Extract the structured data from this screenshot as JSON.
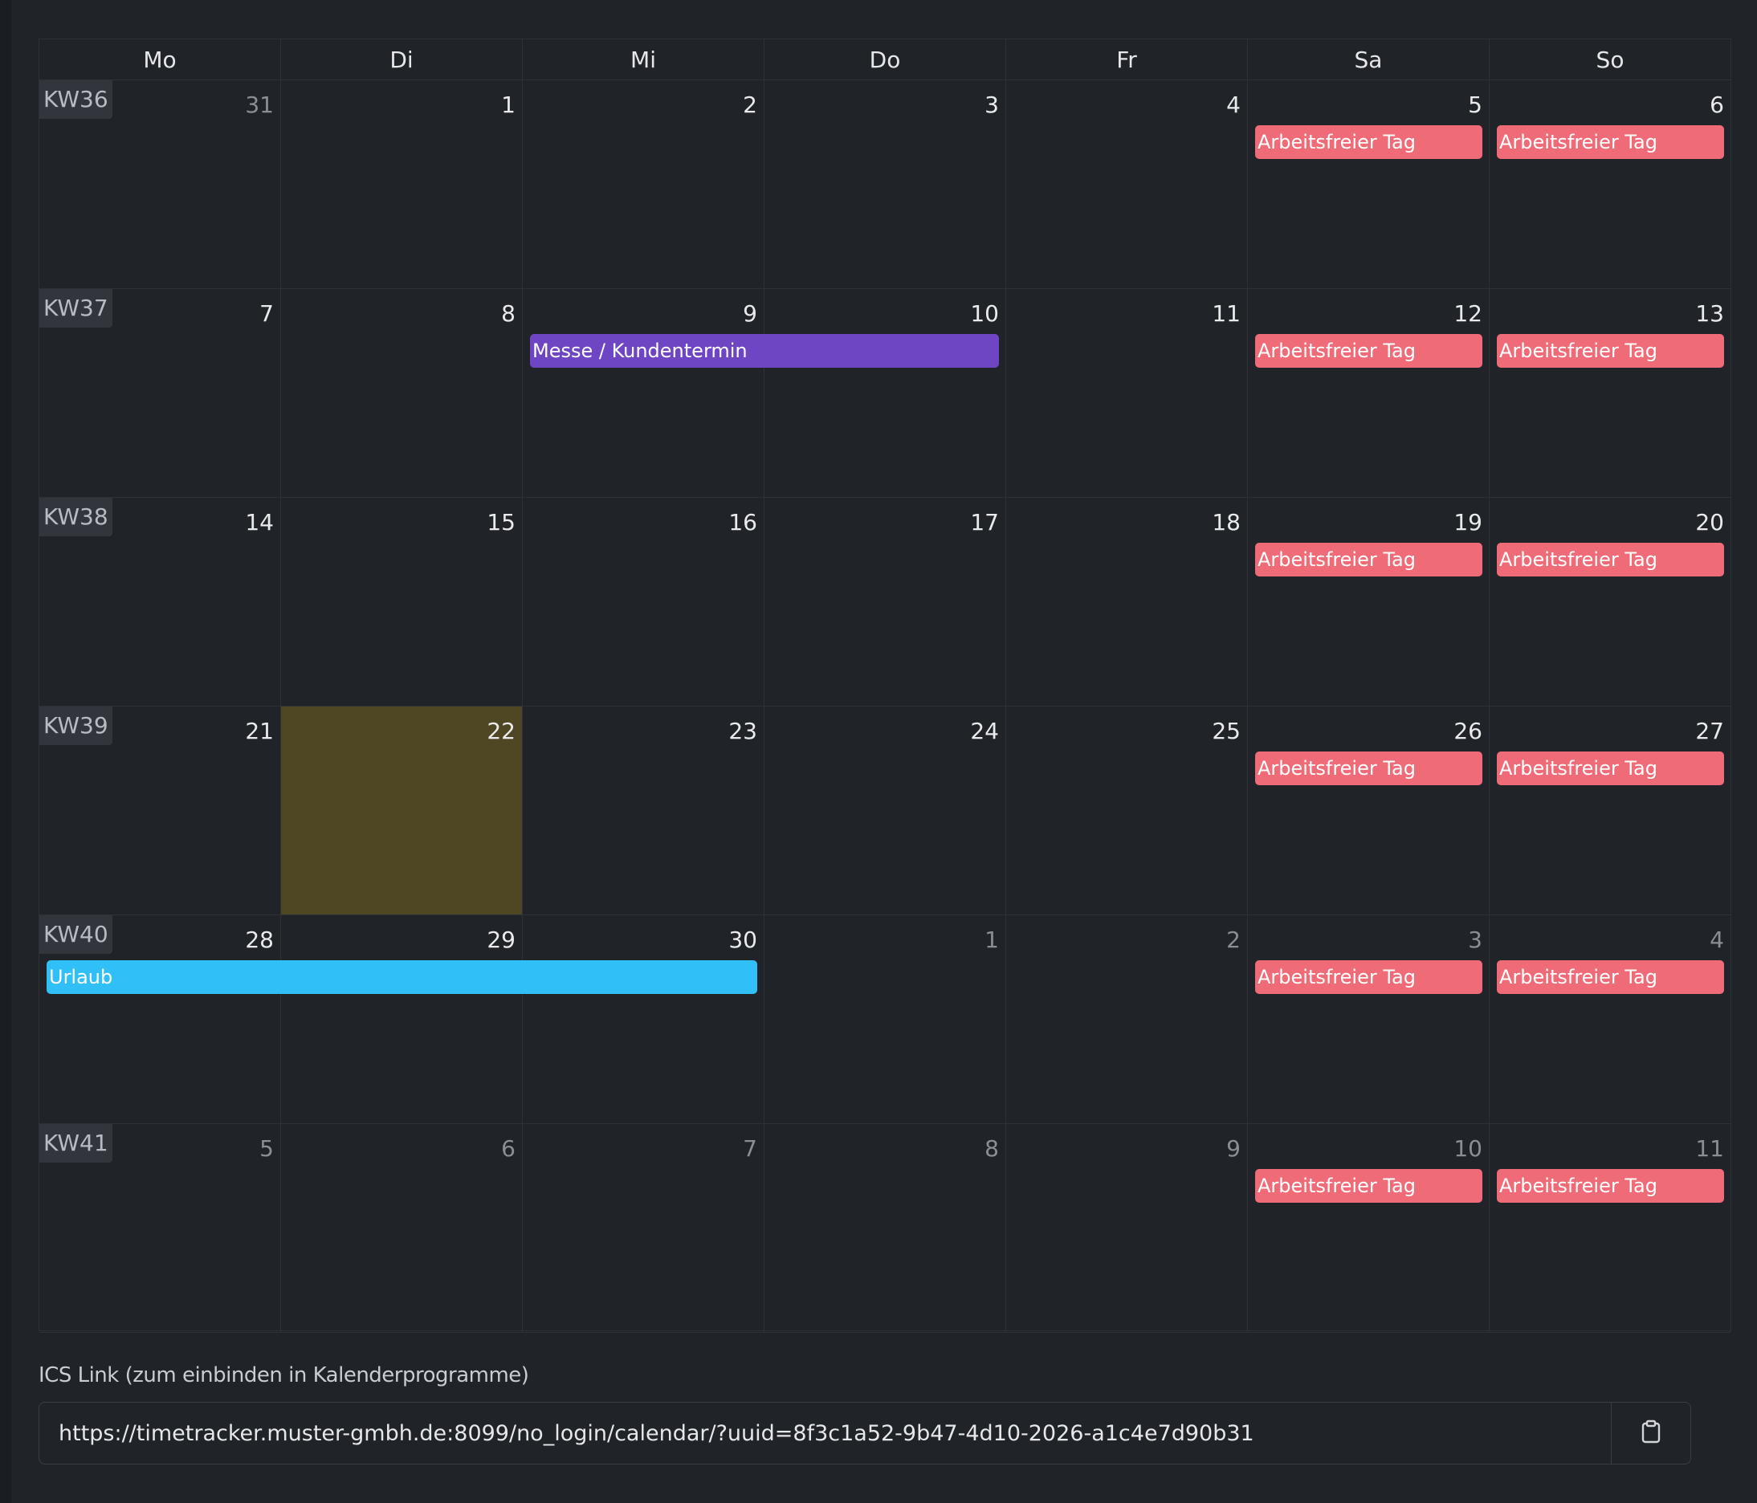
{
  "colors": {
    "background": "#202328",
    "today": "#4f4724",
    "holiday": "#ee6b77",
    "messe": "#6e45c2",
    "urlaub": "#31bff7"
  },
  "weekdays": [
    "Mo",
    "Di",
    "Mi",
    "Do",
    "Fr",
    "Sa",
    "So"
  ],
  "weeks": [
    {
      "kw": "KW36",
      "days": [
        {
          "num": "31",
          "muted": true
        },
        {
          "num": "1"
        },
        {
          "num": "2"
        },
        {
          "num": "3"
        },
        {
          "num": "4"
        },
        {
          "num": "5",
          "event": "Arbeitsfreier Tag"
        },
        {
          "num": "6",
          "event": "Arbeitsfreier Tag"
        }
      ]
    },
    {
      "kw": "KW37",
      "days": [
        {
          "num": "7"
        },
        {
          "num": "8"
        },
        {
          "num": "9"
        },
        {
          "num": "10"
        },
        {
          "num": "11"
        },
        {
          "num": "12",
          "event": "Arbeitsfreier Tag"
        },
        {
          "num": "13",
          "event": "Arbeitsfreier Tag"
        }
      ],
      "span_event": {
        "label": "Messe / Kundentermin",
        "start": 2,
        "end": 3,
        "color": "messe"
      }
    },
    {
      "kw": "KW38",
      "days": [
        {
          "num": "14"
        },
        {
          "num": "15"
        },
        {
          "num": "16"
        },
        {
          "num": "17"
        },
        {
          "num": "18"
        },
        {
          "num": "19",
          "event": "Arbeitsfreier Tag"
        },
        {
          "num": "20",
          "event": "Arbeitsfreier Tag"
        }
      ]
    },
    {
      "kw": "KW39",
      "days": [
        {
          "num": "21"
        },
        {
          "num": "22",
          "today": true
        },
        {
          "num": "23"
        },
        {
          "num": "24"
        },
        {
          "num": "25"
        },
        {
          "num": "26",
          "event": "Arbeitsfreier Tag"
        },
        {
          "num": "27",
          "event": "Arbeitsfreier Tag"
        }
      ]
    },
    {
      "kw": "KW40",
      "days": [
        {
          "num": "28"
        },
        {
          "num": "29"
        },
        {
          "num": "30"
        },
        {
          "num": "1",
          "muted": true
        },
        {
          "num": "2",
          "muted": true
        },
        {
          "num": "3",
          "muted": true,
          "event": "Arbeitsfreier Tag"
        },
        {
          "num": "4",
          "muted": true,
          "event": "Arbeitsfreier Tag"
        }
      ],
      "span_event": {
        "label": "Urlaub",
        "start": 0,
        "end": 2,
        "color": "urlaub"
      }
    },
    {
      "kw": "KW41",
      "days": [
        {
          "num": "5",
          "muted": true
        },
        {
          "num": "6",
          "muted": true
        },
        {
          "num": "7",
          "muted": true
        },
        {
          "num": "8",
          "muted": true
        },
        {
          "num": "9",
          "muted": true
        },
        {
          "num": "10",
          "muted": true,
          "event": "Arbeitsfreier Tag"
        },
        {
          "num": "11",
          "muted": true,
          "event": "Arbeitsfreier Tag"
        }
      ]
    }
  ],
  "ics": {
    "label": "ICS Link (zum einbinden in Kalenderprogramme)",
    "url": "https://timetracker.muster-gmbh.de:8099/no_login/calendar/?uuid=8f3c1a52-9b47-4d10-2026-a1c4e7d90b31",
    "copy_icon": "clipboard-icon"
  }
}
